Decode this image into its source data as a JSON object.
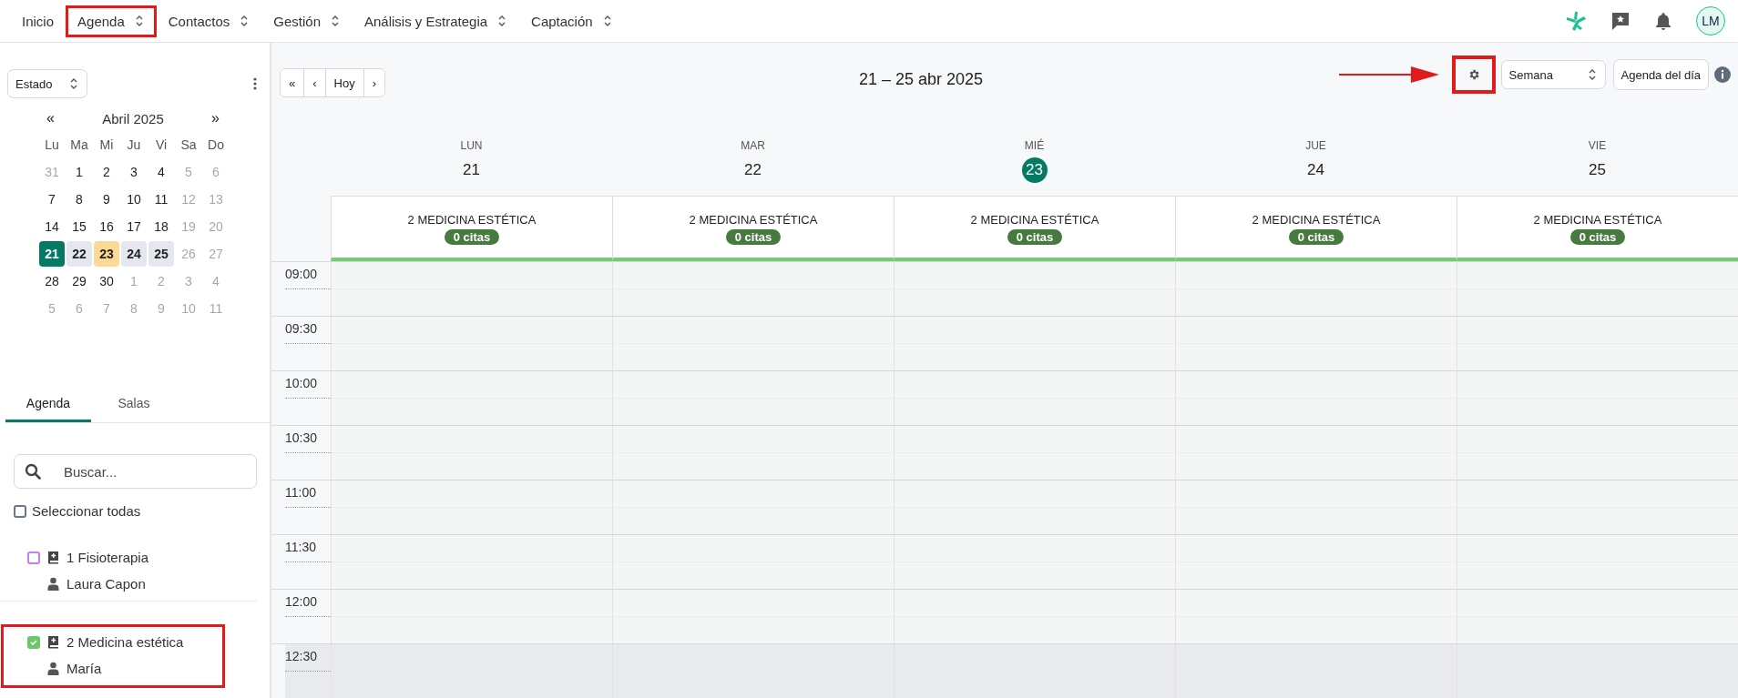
{
  "nav": {
    "items": [
      {
        "label": "Inicio",
        "has_menu": false,
        "highlighted": false
      },
      {
        "label": "Agenda",
        "has_menu": true,
        "highlighted": true
      },
      {
        "label": "Contactos",
        "has_menu": true,
        "highlighted": false
      },
      {
        "label": "Gestión",
        "has_menu": true,
        "highlighted": false
      },
      {
        "label": "Análisis y Estrategia",
        "has_menu": true,
        "highlighted": false
      },
      {
        "label": "Captación",
        "has_menu": true,
        "highlighted": false
      }
    ],
    "avatar": "LM"
  },
  "sidebar": {
    "status_select": "Estado",
    "mini_calendar": {
      "prev": "«",
      "title": "Abril 2025",
      "next": "»",
      "weekdays": [
        "Lu",
        "Ma",
        "Mi",
        "Ju",
        "Vi",
        "Sa",
        "Do"
      ],
      "days": [
        {
          "label": "31",
          "muted": true,
          "selected": false,
          "in_week": false,
          "today": false
        },
        {
          "label": "1",
          "muted": false,
          "selected": false,
          "in_week": false,
          "today": false
        },
        {
          "label": "2",
          "muted": false,
          "selected": false,
          "in_week": false,
          "today": false
        },
        {
          "label": "3",
          "muted": false,
          "selected": false,
          "in_week": false,
          "today": false
        },
        {
          "label": "4",
          "muted": false,
          "selected": false,
          "in_week": false,
          "today": false
        },
        {
          "label": "5",
          "muted": true,
          "selected": false,
          "in_week": false,
          "today": false
        },
        {
          "label": "6",
          "muted": true,
          "selected": false,
          "in_week": false,
          "today": false
        },
        {
          "label": "7",
          "muted": false,
          "selected": false,
          "in_week": false,
          "today": false
        },
        {
          "label": "8",
          "muted": false,
          "selected": false,
          "in_week": false,
          "today": false
        },
        {
          "label": "9",
          "muted": false,
          "selected": false,
          "in_week": false,
          "today": false
        },
        {
          "label": "10",
          "muted": false,
          "selected": false,
          "in_week": false,
          "today": false
        },
        {
          "label": "11",
          "muted": false,
          "selected": false,
          "in_week": false,
          "today": false
        },
        {
          "label": "12",
          "muted": true,
          "selected": false,
          "in_week": false,
          "today": false
        },
        {
          "label": "13",
          "muted": true,
          "selected": false,
          "in_week": false,
          "today": false
        },
        {
          "label": "14",
          "muted": false,
          "selected": false,
          "in_week": false,
          "today": false
        },
        {
          "label": "15",
          "muted": false,
          "selected": false,
          "in_week": false,
          "today": false
        },
        {
          "label": "16",
          "muted": false,
          "selected": false,
          "in_week": false,
          "today": false
        },
        {
          "label": "17",
          "muted": false,
          "selected": false,
          "in_week": false,
          "today": false
        },
        {
          "label": "18",
          "muted": false,
          "selected": false,
          "in_week": false,
          "today": false
        },
        {
          "label": "19",
          "muted": true,
          "selected": false,
          "in_week": false,
          "today": false
        },
        {
          "label": "20",
          "muted": true,
          "selected": false,
          "in_week": false,
          "today": false
        },
        {
          "label": "21",
          "muted": false,
          "selected": true,
          "in_week": true,
          "today": false
        },
        {
          "label": "22",
          "muted": false,
          "selected": false,
          "in_week": true,
          "today": false
        },
        {
          "label": "23",
          "muted": false,
          "selected": false,
          "in_week": true,
          "today": true
        },
        {
          "label": "24",
          "muted": false,
          "selected": false,
          "in_week": true,
          "today": false
        },
        {
          "label": "25",
          "muted": false,
          "selected": false,
          "in_week": true,
          "today": false
        },
        {
          "label": "26",
          "muted": true,
          "selected": false,
          "in_week": false,
          "today": false
        },
        {
          "label": "27",
          "muted": true,
          "selected": false,
          "in_week": false,
          "today": false
        },
        {
          "label": "28",
          "muted": false,
          "selected": false,
          "in_week": false,
          "today": false
        },
        {
          "label": "29",
          "muted": false,
          "selected": false,
          "in_week": false,
          "today": false
        },
        {
          "label": "30",
          "muted": false,
          "selected": false,
          "in_week": false,
          "today": false
        },
        {
          "label": "1",
          "muted": true,
          "selected": false,
          "in_week": false,
          "today": false
        },
        {
          "label": "2",
          "muted": true,
          "selected": false,
          "in_week": false,
          "today": false
        },
        {
          "label": "3",
          "muted": true,
          "selected": false,
          "in_week": false,
          "today": false
        },
        {
          "label": "4",
          "muted": true,
          "selected": false,
          "in_week": false,
          "today": false
        },
        {
          "label": "5",
          "muted": true,
          "selected": false,
          "in_week": false,
          "today": false
        },
        {
          "label": "6",
          "muted": true,
          "selected": false,
          "in_week": false,
          "today": false
        },
        {
          "label": "7",
          "muted": true,
          "selected": false,
          "in_week": false,
          "today": false
        },
        {
          "label": "8",
          "muted": true,
          "selected": false,
          "in_week": false,
          "today": false
        },
        {
          "label": "9",
          "muted": true,
          "selected": false,
          "in_week": false,
          "today": false
        },
        {
          "label": "10",
          "muted": true,
          "selected": false,
          "in_week": false,
          "today": false
        },
        {
          "label": "11",
          "muted": true,
          "selected": false,
          "in_week": false,
          "today": false
        }
      ]
    },
    "tabs": [
      {
        "label": "Agenda",
        "selected": true
      },
      {
        "label": "Salas",
        "selected": false
      }
    ],
    "search": {
      "placeholder": "Buscar..."
    },
    "select_all": {
      "label": "Seleccionar todas",
      "checked": false
    },
    "agendas": [
      {
        "name": "1 Fisioterapia",
        "person": "Laura Capon",
        "checked": false,
        "color": "#c77dea",
        "highlighted": false
      },
      {
        "name": "2 Medicina estética",
        "person": "María",
        "checked": true,
        "color": "#6cc76c",
        "highlighted": true
      }
    ]
  },
  "toolbar": {
    "buttons": [
      "«",
      "‹",
      "Hoy",
      "›"
    ],
    "title": "21 – 25 abr 2025",
    "settings_highlighted": true,
    "view_select": "Semana",
    "day_agenda_button": "Agenda del día"
  },
  "days": [
    {
      "weekday": "LUN",
      "date": "21",
      "today": false,
      "resource": "2 MEDICINA ESTÉTICA",
      "count": "0 citas"
    },
    {
      "weekday": "MAR",
      "date": "22",
      "today": false,
      "resource": "2 MEDICINA ESTÉTICA",
      "count": "0 citas"
    },
    {
      "weekday": "MIÉ",
      "date": "23",
      "today": true,
      "resource": "2 MEDICINA ESTÉTICA",
      "count": "0 citas"
    },
    {
      "weekday": "JUE",
      "date": "24",
      "today": false,
      "resource": "2 MEDICINA ESTÉTICA",
      "count": "0 citas"
    },
    {
      "weekday": "VIE",
      "date": "25",
      "today": false,
      "resource": "2 MEDICINA ESTÉTICA",
      "count": "0 citas"
    }
  ],
  "time_slots": [
    {
      "label": "09:00",
      "shaded": false
    },
    {
      "label": "09:30",
      "shaded": false
    },
    {
      "label": "10:00",
      "shaded": false
    },
    {
      "label": "10:30",
      "shaded": false
    },
    {
      "label": "11:00",
      "shaded": false
    },
    {
      "label": "11:30",
      "shaded": false
    },
    {
      "label": "12:00",
      "shaded": false
    },
    {
      "label": "12:30",
      "shaded": true
    }
  ]
}
